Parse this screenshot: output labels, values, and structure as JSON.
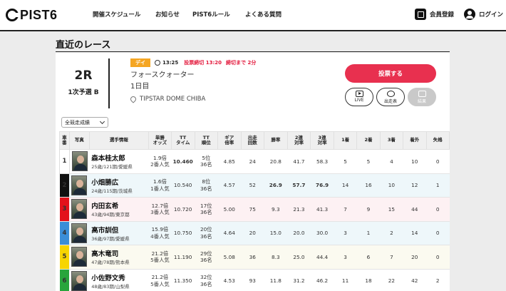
{
  "header": {
    "logo": "PIST6",
    "nav": [
      "開催スケジュール",
      "お知らせ",
      "PIST6ルール",
      "よくある質問"
    ],
    "register": "会員登録",
    "login": "ログイン"
  },
  "section_title": "直近のレース",
  "race": {
    "number": "2R",
    "class": "1次予選 B",
    "badge": "デイ",
    "time": "13:25",
    "deadline": "投票締切 13:20",
    "remaining": "締切まで 2分",
    "name": "フォースクォーター",
    "day": "1日目",
    "venue": "TIPSTAR DOME CHIBA"
  },
  "buttons": {
    "vote": "投票する",
    "live": "LIVE",
    "entries": "出走表",
    "results": "結果"
  },
  "filter": {
    "selected": "全競走成績"
  },
  "table": {
    "headers": [
      "車番",
      "写真",
      "選手情報",
      "単勝\nオッズ",
      "TT\nタイム",
      "TT\n順位",
      "ギア\n倍率",
      "出走\n回数",
      "勝率",
      "2連\n対率",
      "3連\n対率",
      "1着",
      "2着",
      "3着",
      "着外",
      "失格"
    ],
    "rows": [
      {
        "no": "1",
        "name": "森本桂太郎",
        "profile": "25歳/121期/愛媛県",
        "odds": "1.9倍",
        "pop": "2番人気",
        "tt": "10.460",
        "rank": "5位",
        "of": "36名",
        "gear": "4.85",
        "runs": "24",
        "win": "20.8",
        "q2": "41.7",
        "q3": "58.3",
        "f1": "5",
        "f2": "5",
        "f3": "4",
        "out": "10",
        "dq": "0"
      },
      {
        "no": "2",
        "name": "小畑勝広",
        "profile": "24歳/115期/茨城県",
        "odds": "1.6倍",
        "pop": "1番人気",
        "tt": "10.540",
        "rank": "8位",
        "of": "36名",
        "gear": "4.57",
        "runs": "52",
        "win": "26.9",
        "q2": "57.7",
        "q3": "76.9",
        "f1": "14",
        "f2": "16",
        "f3": "10",
        "out": "12",
        "dq": "1"
      },
      {
        "no": "3",
        "name": "内田玄希",
        "profile": "43歳/94期/東京都",
        "odds": "12.7倍",
        "pop": "3番人気",
        "tt": "10.720",
        "rank": "17位",
        "of": "36名",
        "gear": "5.00",
        "runs": "75",
        "win": "9.3",
        "q2": "21.3",
        "q3": "41.3",
        "f1": "7",
        "f2": "9",
        "f3": "15",
        "out": "44",
        "dq": "0"
      },
      {
        "no": "4",
        "name": "高市訓但",
        "profile": "36歳/97期/愛媛県",
        "odds": "15.9倍",
        "pop": "4番人気",
        "tt": "10.750",
        "rank": "20位",
        "of": "36名",
        "gear": "4.64",
        "runs": "20",
        "win": "15.0",
        "q2": "20.0",
        "q3": "30.0",
        "f1": "3",
        "f2": "1",
        "f3": "2",
        "out": "14",
        "dq": "0"
      },
      {
        "no": "5",
        "name": "高木竜司",
        "profile": "47歳/78期/熊本県",
        "odds": "21.2倍",
        "pop": "5番人気",
        "tt": "11.190",
        "rank": "29位",
        "of": "36名",
        "gear": "5.08",
        "runs": "36",
        "win": "8.3",
        "q2": "25.0",
        "q3": "44.4",
        "f1": "3",
        "f2": "6",
        "f3": "7",
        "out": "20",
        "dq": "0"
      },
      {
        "no": "6",
        "name": "小佐野文秀",
        "profile": "48歳/83期/山梨県",
        "odds": "21.2倍",
        "pop": "5番人気",
        "tt": "11.350",
        "rank": "32位",
        "of": "36名",
        "gear": "4.53",
        "runs": "93",
        "win": "11.8",
        "q2": "31.2",
        "q3": "46.2",
        "f1": "11",
        "f2": "18",
        "f3": "22",
        "out": "42",
        "dq": "2"
      }
    ]
  },
  "colors": {
    "accent": "#e8304f",
    "badge": "#f5a623",
    "highlight": "#e3173a"
  }
}
